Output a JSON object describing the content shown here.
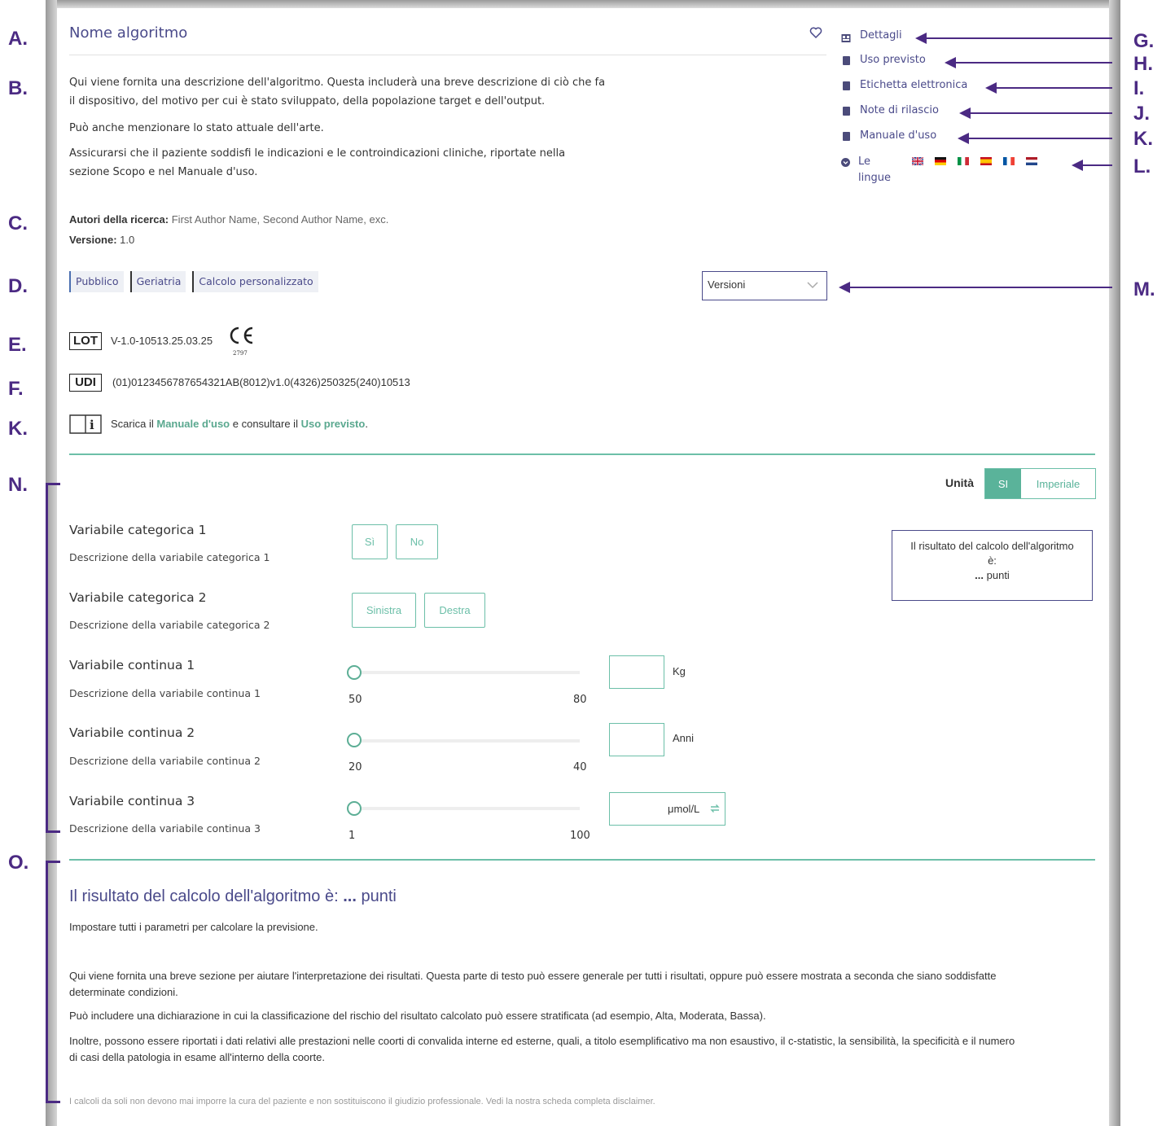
{
  "header": {
    "title": "Nome algoritmo",
    "description_lines": [
      "Qui viene fornita una descrizione dell'algoritmo. Questa includerà una breve descrizione di ciò che fa",
      "il dispositivo, del motivo per cui è stato sviluppato, della popolazione target e dell'output.",
      "Può anche menzionare lo stato attuale dell'arte.",
      "Assicurarsi che il paziente soddisfi le indicazioni e le controindicazioni cliniche, riportate nella",
      "sezione Scopo e nel Manuale d'uso."
    ],
    "authors_label": "Autori della ricerca:",
    "authors_value": "First Author Name, Second Author Name, exc.",
    "version_label": "Versione:",
    "version_value": "1.0"
  },
  "tags": [
    "Pubblico",
    "Geriatria",
    "Calcolo personalizzato"
  ],
  "versions_select": {
    "selected": "Versioni"
  },
  "lot": {
    "badge": "LOT",
    "value": "V-1.0-10513.25.03.25",
    "ce_number": "2797"
  },
  "udi": {
    "badge": "UDI",
    "value": "(01)0123456787654321AB(8012)v1.0(4326)250325(240)10513"
  },
  "manual_note": {
    "pre": "Scarica il ",
    "manual_link": "Manuale d'uso",
    "mid": " e consultare il ",
    "use_link": "Uso previsto",
    "post": "."
  },
  "side_menu": {
    "items": [
      "Dettagli",
      "Uso previsto",
      "Etichetta elettronica",
      "Note di rilascio",
      "Manuale d'uso"
    ],
    "languages_label_line1": "Le",
    "languages_label_line2": "lingue",
    "flags": [
      "uk",
      "de",
      "it",
      "es",
      "fr",
      "nl"
    ]
  },
  "annotations": {
    "left": [
      "A.",
      "B.",
      "C.",
      "D.",
      "E.",
      "F.",
      "K.",
      "N.",
      "O."
    ],
    "right": [
      "G.",
      "H.",
      "I.",
      "J.",
      "K.",
      "L.",
      "M."
    ]
  },
  "units_toggle": {
    "label": "Unità",
    "options": [
      "SI",
      "Imperiale"
    ],
    "selected": "SI"
  },
  "variables": {
    "cat1": {
      "name": "Variabile categorica 1",
      "desc": "Descrizione della variabile categorica 1",
      "options": [
        "Sì",
        "No"
      ]
    },
    "cat2": {
      "name": "Variabile categorica 2",
      "desc": "Descrizione della variabile categorica 2",
      "options": [
        "Sinistra",
        "Destra"
      ]
    },
    "cont1": {
      "name": "Variabile continua 1",
      "desc": "Descrizione della variabile continua 1",
      "min": "50",
      "max": "80",
      "unit": "Kg"
    },
    "cont2": {
      "name": "Variabile continua 2",
      "desc": "Descrizione della variabile continua 2",
      "min": "20",
      "max": "40",
      "unit": "Anni"
    },
    "cont3": {
      "name": "Variabile continua 3",
      "desc": "Descrizione della variabile continua 3",
      "min": "1",
      "max": "100",
      "unit": "μmol/L"
    }
  },
  "result_box": {
    "line1": "Il risultato del calcolo dell'algoritmo",
    "line2": "è:",
    "dots": "...",
    "points": "punti"
  },
  "result_section": {
    "heading": "Il risultato del calcolo dell'algoritmo è:",
    "heading_dots": "...",
    "heading_points": "punti",
    "set_params": "Impostare tutti i parametri per calcolare la previsione.",
    "para1_line1": "Qui viene fornita una breve sezione per aiutare l'interpretazione dei risultati. Questa parte di testo può essere generale per tutti i risultati, oppure può essere mostrata a seconda che siano soddisfatte",
    "para1_line2": "determinate condizioni.",
    "para2": "Può includere una dichiarazione in cui la classificazione del rischio del risultato calcolato può essere stratificata (ad esempio, Alta, Moderata, Bassa).",
    "para3_line1": "Inoltre, possono essere riportati i dati relativi alle prestazioni nelle coorti di convalida interne ed esterne, quali, a titolo esemplificativo ma non esaustivo, il c-statistic, la sensibilità, la specificità e il numero",
    "para3_line2": "di casi della patologia in esame all'interno della coorte.",
    "disclaimer": "I calcoli da soli non devono mai imporre la cura del paziente e non sostituiscono il giudizio professionale. Vedi la nostra scheda completa disclaimer."
  },
  "colors": {
    "accent_purple": "#4b2a83",
    "teal": "#6cbfa8",
    "title_blue": "#4a4a8a"
  }
}
